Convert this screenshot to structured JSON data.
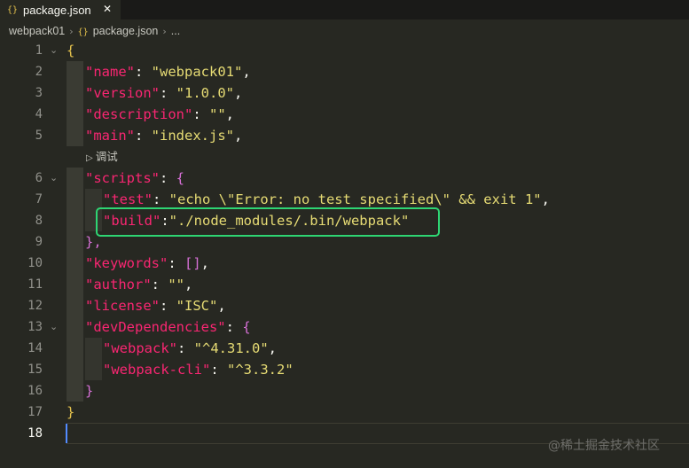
{
  "tab": {
    "icon": "{}",
    "title": "package.json",
    "close": "✕"
  },
  "breadcrumb": {
    "folder": "webpack01",
    "file_icon": "{}",
    "file": "package.json",
    "chevron": "›",
    "more": "..."
  },
  "codelens": {
    "play": "▷",
    "label": "调试"
  },
  "editor": {
    "line_numbers": [
      "1",
      "2",
      "3",
      "4",
      "5",
      "6",
      "7",
      "8",
      "9",
      "10",
      "11",
      "12",
      "13",
      "14",
      "15",
      "16",
      "17",
      "18"
    ],
    "fold_markers": [
      "⌄",
      "⌄",
      "⌄"
    ],
    "tokens": {
      "open_brace": "{",
      "close_brace": "}",
      "colon": ": ",
      "colon_nospace": ":",
      "comma": ",",
      "scripts_open": "{",
      "scripts_close": "},",
      "keywords_val": "[]",
      "devdeps_open": "{",
      "devdeps_close": "}"
    },
    "keys": {
      "name": "\"name\"",
      "version": "\"version\"",
      "description": "\"description\"",
      "main": "\"main\"",
      "scripts": "\"scripts\"",
      "test": "\"test\"",
      "build": "\"build\"",
      "keywords": "\"keywords\"",
      "author": "\"author\"",
      "license": "\"license\"",
      "devDependencies": "\"devDependencies\"",
      "webpack": "\"webpack\"",
      "webpack_cli": "\"webpack-cli\""
    },
    "values": {
      "name": "\"webpack01\"",
      "version": "\"1.0.0\"",
      "description": "\"\"",
      "main": "\"index.js\"",
      "test": "\"echo \\\"Error: no test specified\\\" && exit 1\"",
      "build": "\"./node_modules/.bin/webpack\"",
      "author": "\"\"",
      "license": "\"ISC\"",
      "webpack": "\"^4.31.0\"",
      "webpack_cli": "\"^3.3.2\""
    }
  },
  "watermark": "@稀土掘金技术社区",
  "colors": {
    "background": "#272822",
    "key": "#f92672",
    "string": "#e6db74",
    "brace": "#e2c04c",
    "nested_brace": "#d670d6",
    "highlight_box": "#2ed573",
    "cursor": "#528bff"
  }
}
